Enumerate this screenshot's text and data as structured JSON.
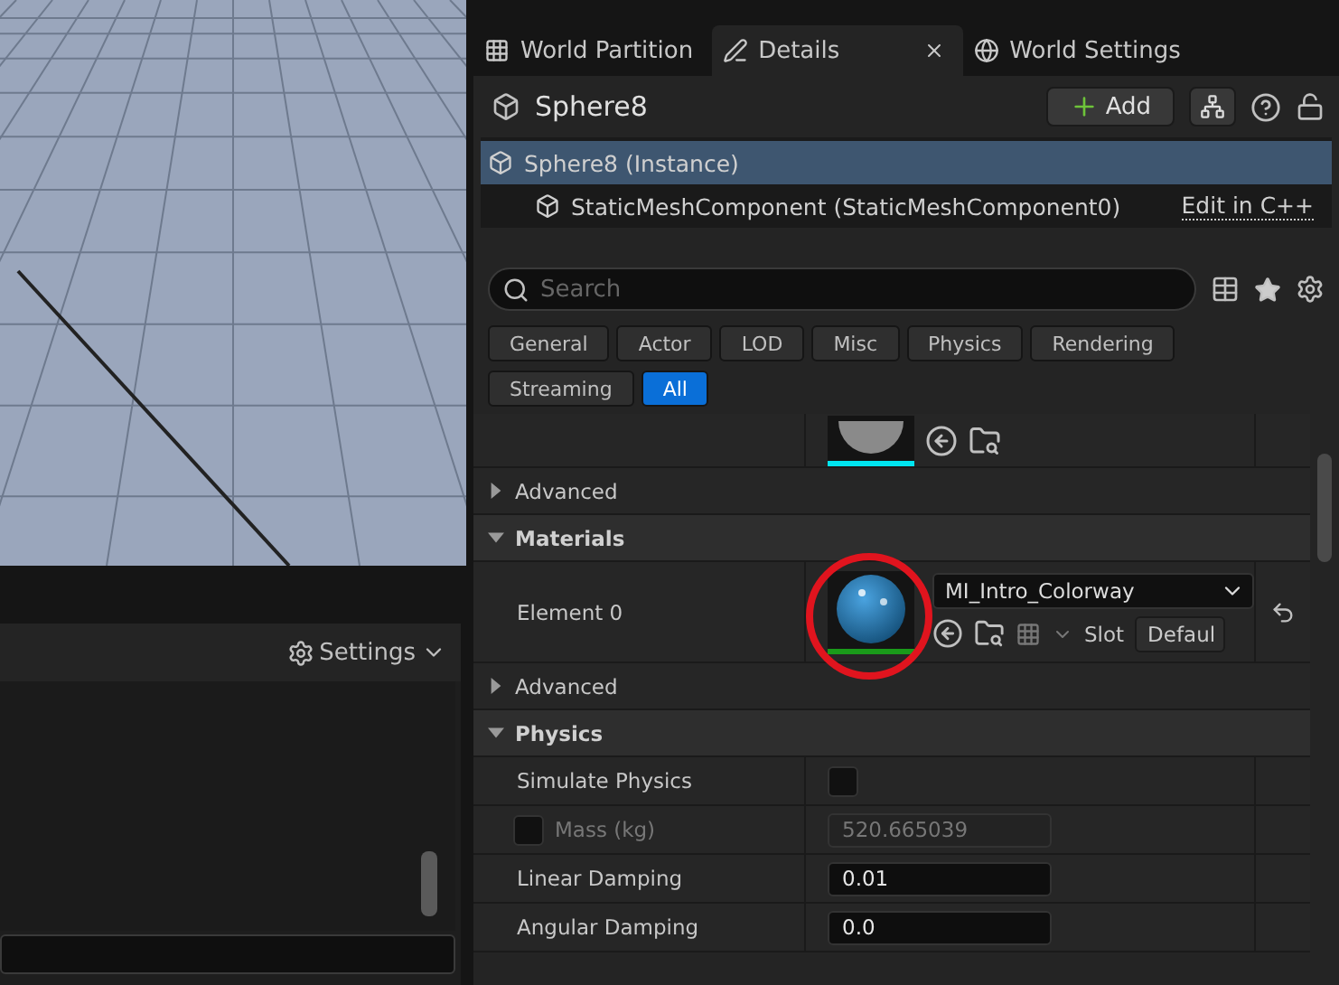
{
  "output_log": {
    "settings_label": "Settings"
  },
  "tabs": [
    {
      "label": "World Partition",
      "selected": false,
      "closable": false
    },
    {
      "label": "Details",
      "selected": true,
      "closable": true
    },
    {
      "label": "World Settings",
      "selected": false,
      "closable": false
    }
  ],
  "actor": {
    "name": "Sphere8",
    "add_label": "Add"
  },
  "tree": [
    {
      "label": "Sphere8 (Instance)",
      "selected": true,
      "children": [
        {
          "label": "StaticMeshComponent (StaticMeshComponent0)",
          "selected": false,
          "link": "Edit in C++"
        }
      ]
    }
  ],
  "search": {
    "placeholder": "Search"
  },
  "filters": [
    {
      "label": "General",
      "selected": false
    },
    {
      "label": "Actor",
      "selected": false
    },
    {
      "label": "LOD",
      "selected": false
    },
    {
      "label": "Misc",
      "selected": false
    },
    {
      "label": "Physics",
      "selected": false
    },
    {
      "label": "Rendering",
      "selected": false
    },
    {
      "label": "Streaming",
      "selected": false
    },
    {
      "label": "All",
      "selected": true
    }
  ],
  "properties": [
    {
      "kind": "asset"
    },
    {
      "kind": "group",
      "label": "Advanced",
      "expanded": false
    },
    {
      "kind": "category",
      "label": "Materials",
      "expanded": true
    },
    {
      "kind": "material",
      "label": "Element 0",
      "value": "MI_Intro_Colorway",
      "slot_label": "Slot",
      "slot_value": "Defaul",
      "highlighted": true
    },
    {
      "kind": "group",
      "label": "Advanced",
      "expanded": false
    },
    {
      "kind": "category",
      "label": "Physics",
      "expanded": true
    },
    {
      "kind": "checkbox",
      "label": "Simulate Physics",
      "checked": false
    },
    {
      "kind": "number",
      "label": "Mass (kg)",
      "value": "520.665039",
      "disabled": true,
      "override": false
    },
    {
      "kind": "number",
      "label": "Linear Damping",
      "value": "0.01",
      "disabled": false
    },
    {
      "kind": "number",
      "label": "Angular Damping",
      "value": "0.0",
      "disabled": false
    }
  ]
}
